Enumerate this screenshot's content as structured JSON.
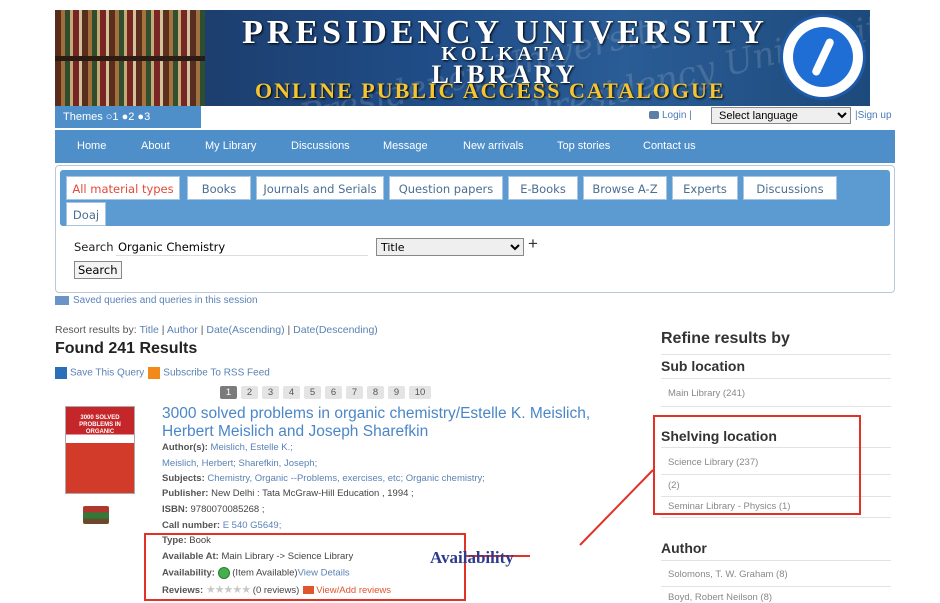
{
  "banner": {
    "title": "PRESIDENCY UNIVERSITY",
    "subtitle": "KOLKATA",
    "library": "LIBRARY",
    "opac": "ONLINE PUBLIC ACCESS CATALOGUE"
  },
  "topbar": {
    "themes_label": "Themes ○1 ●2 ●3",
    "login": "Login |",
    "language": "Select language",
    "signup": "|Sign up"
  },
  "nav": [
    "Home",
    "About",
    "My Library",
    "Discussions",
    "Message",
    "New arrivals",
    "Top stories",
    "Contact us"
  ],
  "tabs": [
    "All material types",
    "Books",
    "Journals and Serials",
    "Question papers",
    "E-Books",
    "Browse A-Z",
    "Experts",
    "Discussions",
    "Doaj"
  ],
  "search": {
    "label": "Search",
    "query": "Organic Chemistry",
    "field": "Title",
    "button": "Search"
  },
  "saved_queries": "Saved queries and queries in this session",
  "results": {
    "resort_label": "Resort results by:",
    "resort_options": [
      "Title",
      "Author",
      "Date(Ascending)",
      "Date(Descending)"
    ],
    "found": "Found 241 Results",
    "save_query": "Save This Query",
    "rss": "Subscribe To RSS Feed",
    "pages": [
      "1",
      "2",
      "3",
      "4",
      "5",
      "6",
      "7",
      "8",
      "9",
      "10"
    ],
    "item": {
      "title": "3000 solved problems in organic chemistry/Estelle K. Meislich, Herbert Meislich and Joseph Sharefkin",
      "cover_text": "3000 SOLVED PROBLEMS IN ORGANIC CHEMISTRY",
      "authors_label": "Author(s):",
      "authors_1": "Meislich, Estelle K.;",
      "authors_2": "Meislich, Herbert; Sharefkin, Joseph;",
      "subjects_label": "Subjects:",
      "subjects": "Chemistry, Organic --Problems, exercises, etc; Organic chemistry;",
      "publisher_label": "Publisher:",
      "publisher": "New Delhi : Tata McGraw-Hill Education , 1994 ;",
      "isbn_label": "ISBN:",
      "isbn": "9780070085268 ;",
      "call_label": "Call number:",
      "call": "E 540 G5649;",
      "type_label": "Type:",
      "type": "Book",
      "available_at_label": "Available At:",
      "available_at": "Main Library -> Science Library",
      "availability_label": "Availability:",
      "availability": "(Item Available)",
      "view_details": "View Details",
      "reviews_label": "Reviews:",
      "stars": "★★★★★",
      "reviews_count": "(0 reviews)",
      "view_add_reviews": "View/Add reviews"
    }
  },
  "refine": {
    "title": "Refine results by",
    "sub_location": "Sub location",
    "sub_items": [
      "Main Library (241)"
    ],
    "shelving": "Shelving location",
    "shelving_items": [
      "Science Library (237)",
      "(2)",
      "Seminar Library - Physics (1)"
    ],
    "author": "Author",
    "author_items": [
      "Solomons, T. W. Graham (8)",
      "Boyd, Robert Neilson (8)"
    ]
  },
  "annotation": {
    "label": "Availability",
    "color": "#e23228"
  }
}
